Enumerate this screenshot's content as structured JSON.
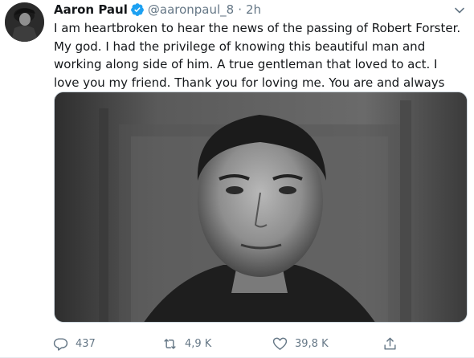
{
  "author": {
    "name": "Aaron Paul",
    "handle": "@aaronpaul_8",
    "separator": "·",
    "time": "2h",
    "verified": true
  },
  "tweet": {
    "text": "I am heartbroken to hear the news of the passing of Robert Forster. My god. I had the privilege of knowing this beautiful man and working along side of him. A true gentleman that loved to act. I love you my friend. Thank you for loving me. You are and always will be a legend."
  },
  "actions": {
    "replies": "437",
    "retweets": "4,9 K",
    "likes": "39,8 K"
  },
  "icons": {
    "verified": "verified-badge-icon",
    "heart": "black-heart-emoji-icon",
    "caret": "chevron-down-icon",
    "reply": "reply-icon",
    "retweet": "retweet-icon",
    "like": "like-heart-icon",
    "share": "share-icon"
  },
  "colors": {
    "accent": "#1da1f2",
    "text": "#14171a",
    "muted": "#657786"
  }
}
